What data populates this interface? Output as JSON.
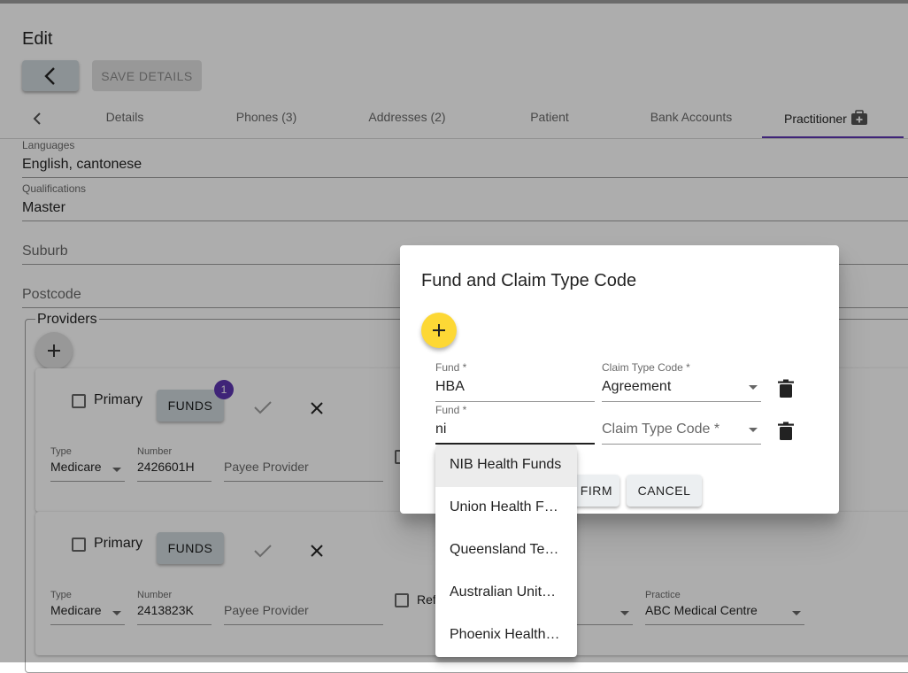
{
  "header": {
    "title": "Edit",
    "save_label": "SAVE DETAILS"
  },
  "tabs": [
    {
      "label": "Details"
    },
    {
      "label": "Phones (3)"
    },
    {
      "label": "Addresses (2)"
    },
    {
      "label": "Patient"
    },
    {
      "label": "Bank Accounts"
    },
    {
      "label": "Practitioner"
    }
  ],
  "form": {
    "languages_label": "Languages",
    "languages_value": "English, cantonese",
    "qualifications_label": "Qualifications",
    "qualifications_value": "Master",
    "suburb_placeholder": "Suburb",
    "postcode_placeholder": "Postcode"
  },
  "providers": {
    "legend": "Providers",
    "cards": [
      {
        "primary_label": "Primary",
        "funds_label": "FUNDS",
        "funds_badge": "1",
        "type_label": "Type",
        "type_value": "Medicare",
        "number_label": "Number",
        "number_value": "2426601H",
        "payee_placeholder": "Payee Provider"
      },
      {
        "primary_label": "Primary",
        "funds_label": "FUNDS",
        "type_label": "Type",
        "type_value": "Medicare",
        "number_label": "Number",
        "number_value": "2413823K",
        "payee_placeholder": "Payee Provider",
        "ref_partial": "Ref",
        "practice_label": "Practice",
        "practice_value": "ABC Medical Centre"
      }
    ]
  },
  "dialog": {
    "title": "Fund and Claim Type Code",
    "rows": [
      {
        "fund_label": "Fund *",
        "fund_value": "HBA",
        "claim_label": "Claim Type Code *",
        "claim_value": "Agreement"
      },
      {
        "fund_label": "Fund *",
        "fund_value": "ni",
        "claim_placeholder": "Claim Type Code *"
      }
    ],
    "confirm_label": "CONFIRM",
    "confirm_visible": "FIRM",
    "cancel_label": "CANCEL"
  },
  "autocomplete": {
    "options": [
      "NIB Health Funds",
      "Union Health Funds",
      "Queensland Teachers",
      "Australian Unity Health",
      "Phoenix Health Fund"
    ],
    "highlighted_index": 0
  },
  "colors": {
    "accent": "#5e35b1",
    "fab": "#fdd835",
    "button": "#cfd8dc"
  }
}
